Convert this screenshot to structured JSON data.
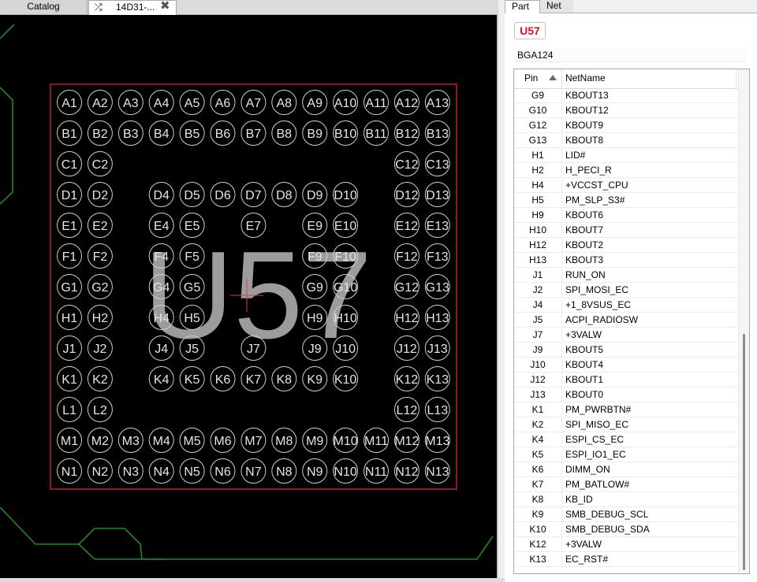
{
  "tabs": {
    "catalog": "Catalog",
    "board": "14D31-..."
  },
  "board_view": {
    "designator": "U57",
    "outline_color": "#e03030",
    "pad_color": "#cfcfcf",
    "trace_color": "#1f8a1f",
    "columns": [
      1,
      2,
      3,
      4,
      5,
      6,
      7,
      8,
      9,
      10,
      11,
      12,
      13
    ],
    "rows": [
      {
        "r": "A",
        "cols": [
          1,
          2,
          3,
          4,
          5,
          6,
          7,
          8,
          9,
          10,
          11,
          12,
          13
        ]
      },
      {
        "r": "B",
        "cols": [
          1,
          2,
          3,
          4,
          5,
          6,
          7,
          8,
          9,
          10,
          11,
          12,
          13
        ]
      },
      {
        "r": "C",
        "cols": [
          1,
          2,
          12,
          13
        ]
      },
      {
        "r": "D",
        "cols": [
          1,
          2,
          4,
          5,
          6,
          7,
          8,
          9,
          10,
          12,
          13
        ]
      },
      {
        "r": "E",
        "cols": [
          1,
          2,
          4,
          5,
          7,
          9,
          10,
          12,
          13
        ]
      },
      {
        "r": "F",
        "cols": [
          1,
          2,
          4,
          5,
          9,
          10,
          12,
          13
        ]
      },
      {
        "r": "G",
        "cols": [
          1,
          2,
          4,
          5,
          9,
          10,
          12,
          13
        ]
      },
      {
        "r": "H",
        "cols": [
          1,
          2,
          4,
          5,
          9,
          10,
          12,
          13
        ]
      },
      {
        "r": "J",
        "cols": [
          1,
          2,
          4,
          5,
          7,
          9,
          10,
          12,
          13
        ]
      },
      {
        "r": "K",
        "cols": [
          1,
          2,
          4,
          5,
          6,
          7,
          8,
          9,
          10,
          12,
          13
        ]
      },
      {
        "r": "L",
        "cols": [
          1,
          2,
          12,
          13
        ]
      },
      {
        "r": "M",
        "cols": [
          1,
          2,
          3,
          4,
          5,
          6,
          7,
          8,
          9,
          10,
          11,
          12,
          13
        ]
      },
      {
        "r": "N",
        "cols": [
          1,
          2,
          3,
          4,
          5,
          6,
          7,
          8,
          9,
          10,
          11,
          12,
          13
        ]
      }
    ]
  },
  "panel": {
    "tab_part": "Part",
    "tab_net": "Net",
    "refdes": "U57",
    "package": "BGA124",
    "col_pin": "Pin",
    "col_net": "NetName",
    "rows": [
      {
        "pin": "G9",
        "net": "KBOUT13"
      },
      {
        "pin": "G10",
        "net": "KBOUT12"
      },
      {
        "pin": "G12",
        "net": "KBOUT9"
      },
      {
        "pin": "G13",
        "net": "KBOUT8"
      },
      {
        "pin": "H1",
        "net": "LID#"
      },
      {
        "pin": "H2",
        "net": "H_PECI_R"
      },
      {
        "pin": "H4",
        "net": "+VCCST_CPU"
      },
      {
        "pin": "H5",
        "net": "PM_SLP_S3#"
      },
      {
        "pin": "H9",
        "net": "KBOUT6"
      },
      {
        "pin": "H10",
        "net": "KBOUT7"
      },
      {
        "pin": "H12",
        "net": "KBOUT2"
      },
      {
        "pin": "H13",
        "net": "KBOUT3"
      },
      {
        "pin": "J1",
        "net": "RUN_ON"
      },
      {
        "pin": "J2",
        "net": "SPI_MOSI_EC"
      },
      {
        "pin": "J4",
        "net": "+1_8VSUS_EC"
      },
      {
        "pin": "J5",
        "net": "ACPI_RADIOSW"
      },
      {
        "pin": "J7",
        "net": "+3VALW"
      },
      {
        "pin": "J9",
        "net": "KBOUT5"
      },
      {
        "pin": "J10",
        "net": "KBOUT4"
      },
      {
        "pin": "J12",
        "net": "KBOUT1"
      },
      {
        "pin": "J13",
        "net": "KBOUT0"
      },
      {
        "pin": "K1",
        "net": "PM_PWRBTN#"
      },
      {
        "pin": "K2",
        "net": "SPI_MISO_EC"
      },
      {
        "pin": "K4",
        "net": "ESPI_CS_EC"
      },
      {
        "pin": "K5",
        "net": "ESPI_IO1_EC"
      },
      {
        "pin": "K6",
        "net": "DIMM_ON"
      },
      {
        "pin": "K7",
        "net": "PM_BATLOW#"
      },
      {
        "pin": "K8",
        "net": "KB_ID"
      },
      {
        "pin": "K9",
        "net": "SMB_DEBUG_SCL"
      },
      {
        "pin": "K10",
        "net": "SMB_DEBUG_SDA"
      },
      {
        "pin": "K12",
        "net": "+3VALW"
      },
      {
        "pin": "K13",
        "net": "EC_RST#"
      }
    ]
  }
}
